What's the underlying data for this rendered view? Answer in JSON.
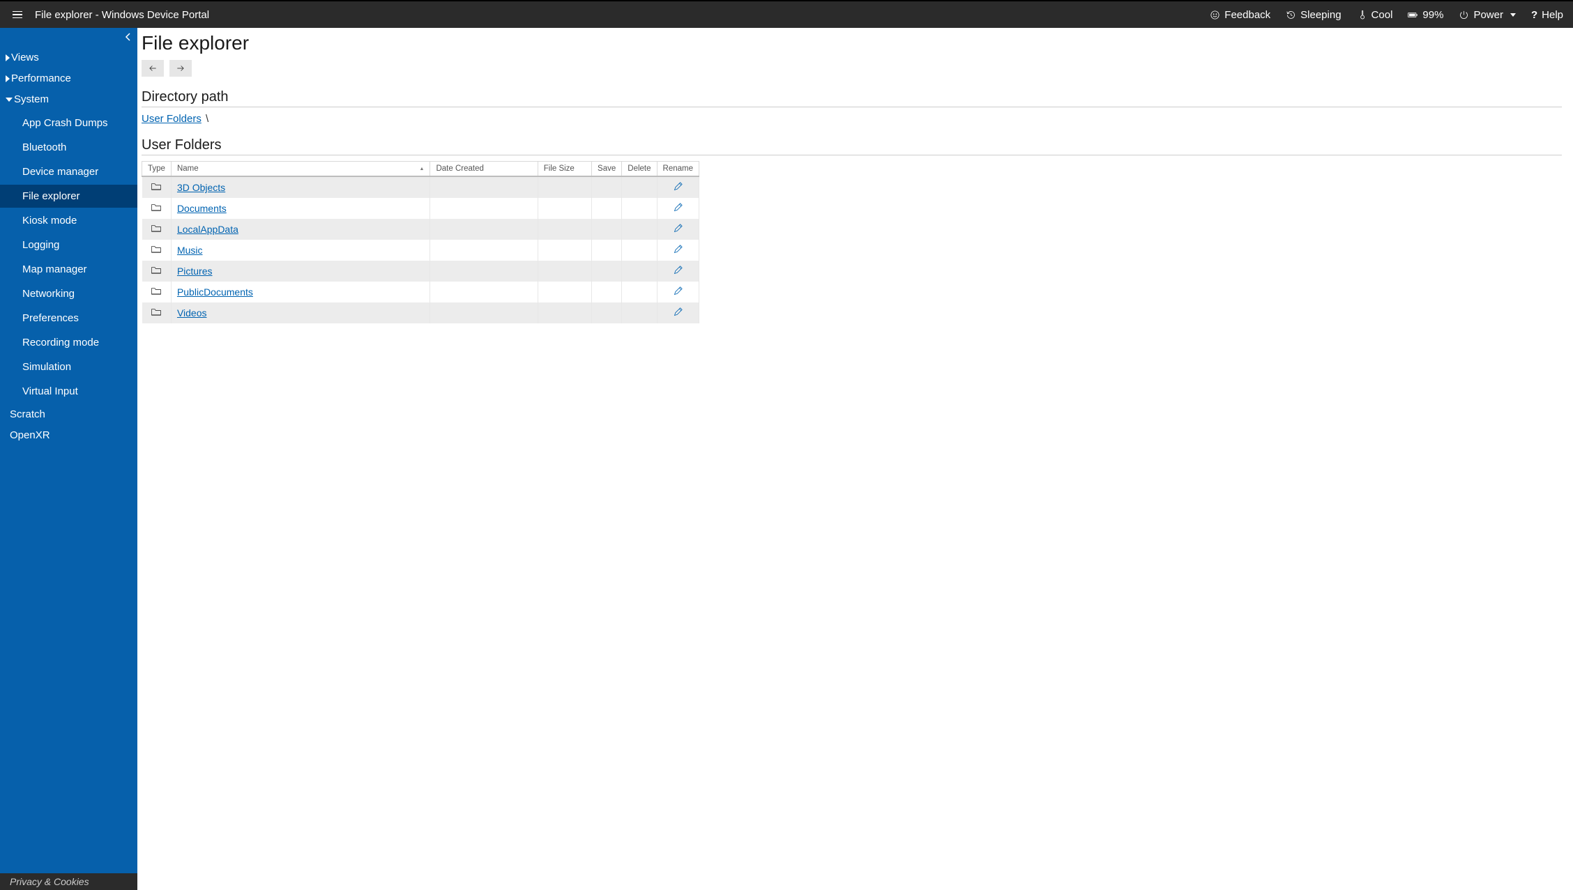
{
  "header": {
    "title": "File explorer - Windows Device Portal",
    "feedback": "Feedback",
    "sleeping": "Sleeping",
    "cool": "Cool",
    "battery": "99%",
    "power": "Power",
    "help": "Help"
  },
  "sidebar": {
    "views": "Views",
    "performance": "Performance",
    "system": "System",
    "system_items": [
      "App Crash Dumps",
      "Bluetooth",
      "Device manager",
      "File explorer",
      "Kiosk mode",
      "Logging",
      "Map manager",
      "Networking",
      "Preferences",
      "Recording mode",
      "Simulation",
      "Virtual Input"
    ],
    "scratch": "Scratch",
    "openxr": "OpenXR",
    "footer": "Privacy & Cookies"
  },
  "main": {
    "title": "File explorer",
    "directory_path_heading": "Directory path",
    "breadcrumb_root": "User Folders",
    "breadcrumb_sep": "\\",
    "section_heading": "User Folders",
    "columns": {
      "type": "Type",
      "name": "Name",
      "date": "Date Created",
      "size": "File Size",
      "save": "Save",
      "delete": "Delete",
      "rename": "Rename"
    },
    "rows": [
      {
        "name": "3D Objects"
      },
      {
        "name": "Documents"
      },
      {
        "name": "LocalAppData"
      },
      {
        "name": "Music"
      },
      {
        "name": "Pictures"
      },
      {
        "name": "PublicDocuments"
      },
      {
        "name": "Videos"
      }
    ]
  }
}
